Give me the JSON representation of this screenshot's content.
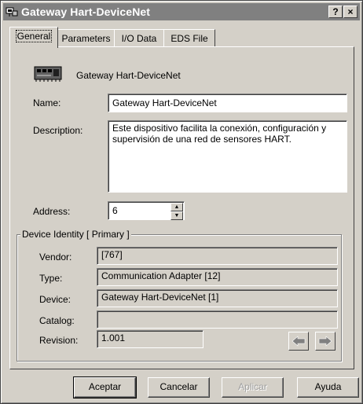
{
  "window": {
    "title": "Gateway Hart-DeviceNet",
    "help_label": "?",
    "close_label": "×"
  },
  "tabs": [
    {
      "label": "General",
      "active": true
    },
    {
      "label": "Parameters",
      "active": false
    },
    {
      "label": "I/O Data",
      "active": false
    },
    {
      "label": "EDS File",
      "active": false
    }
  ],
  "general": {
    "device_title": "Gateway Hart-DeviceNet",
    "name_label": "Name:",
    "name_value": "Gateway Hart-DeviceNet",
    "description_label": "Description:",
    "description_value": "Este dispositivo facilita la conexión, configuración y supervisión de una red de sensores HART.",
    "address_label": "Address:",
    "address_value": "6"
  },
  "identity": {
    "group_title": "Device Identity [ Primary ]",
    "vendor_label": "Vendor:",
    "vendor_value": "[767]",
    "type_label": "Type:",
    "type_value": "Communication Adapter [12]",
    "device_label": "Device:",
    "device_value": "Gateway Hart-DeviceNet [1]",
    "catalog_label": "Catalog:",
    "catalog_value": "",
    "revision_label": "Revision:",
    "revision_value": "1.001"
  },
  "buttons": {
    "accept": "Aceptar",
    "cancel": "Cancelar",
    "apply": "Aplicar",
    "help": "Ayuda"
  },
  "icons": {
    "app": "network-device-icon",
    "device": "circuit-board-icon",
    "prev": "arrow-left-icon",
    "next": "arrow-right-icon"
  }
}
